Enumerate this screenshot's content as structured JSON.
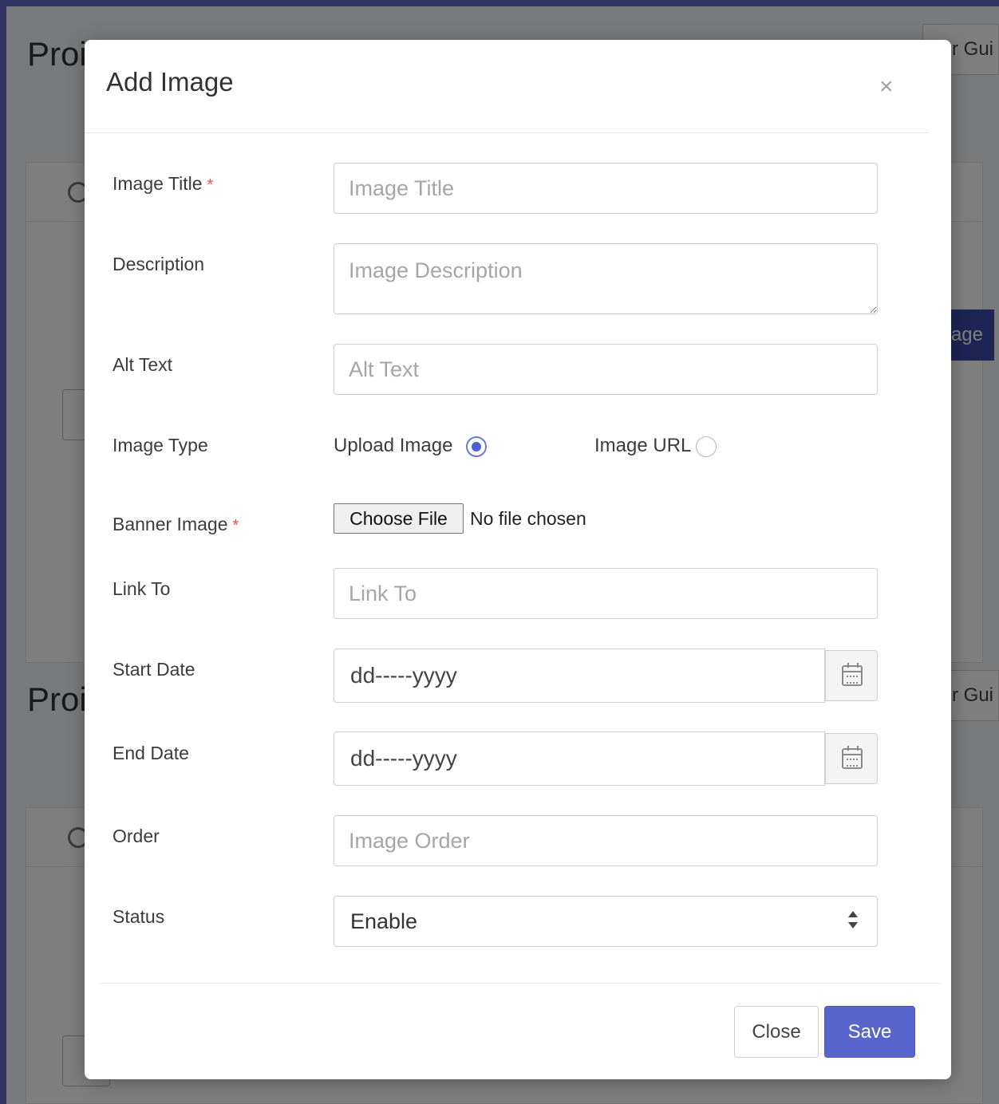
{
  "background": {
    "title_1": "Proi",
    "title_2": "Proi",
    "guide_button_1": "r Gui",
    "guide_button_2": "r Gui",
    "add_button_fragment": "age"
  },
  "modal": {
    "title": "Add Image",
    "close_glyph": "×",
    "fields": {
      "image_title": {
        "label": "Image Title",
        "required_mark": "*",
        "placeholder": "Image Title",
        "value": ""
      },
      "description": {
        "label": "Description",
        "placeholder": "Image Description",
        "value": ""
      },
      "alt_text": {
        "label": "Alt Text",
        "placeholder": "Alt Text",
        "value": ""
      },
      "image_type": {
        "label": "Image Type",
        "options": [
          {
            "label": "Upload Image",
            "checked": true
          },
          {
            "label": "Image URL",
            "checked": false
          }
        ]
      },
      "banner_image": {
        "label": "Banner Image",
        "required_mark": "*",
        "button_label": "Choose File",
        "status": "No file chosen"
      },
      "link_to": {
        "label": "Link To",
        "placeholder": "Link To",
        "value": ""
      },
      "start_date": {
        "label": "Start Date",
        "value": "dd-----yyyy"
      },
      "end_date": {
        "label": "End Date",
        "value": "dd-----yyyy"
      },
      "order": {
        "label": "Order",
        "placeholder": "Image Order",
        "value": ""
      },
      "status": {
        "label": "Status",
        "selected": "Enable"
      }
    },
    "footer": {
      "close_label": "Close",
      "save_label": "Save"
    }
  },
  "colors": {
    "primary": "#5865cc",
    "required": "#e5533d",
    "radio_checked": "#4e5fd1"
  }
}
